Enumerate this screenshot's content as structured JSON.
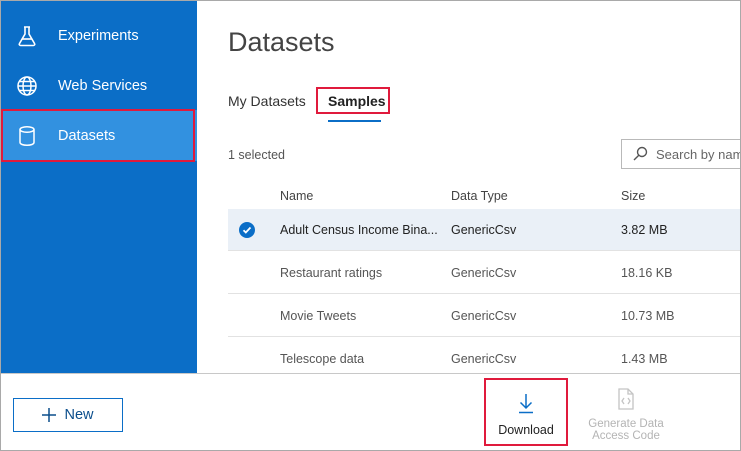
{
  "sidebar": {
    "items": [
      {
        "label": "Experiments",
        "icon": "flask-icon"
      },
      {
        "label": "Web Services",
        "icon": "globe-icon"
      },
      {
        "label": "Datasets",
        "icon": "database-icon",
        "active": true
      }
    ]
  },
  "main": {
    "title": "Datasets",
    "tabs": [
      {
        "label": "My Datasets",
        "active": false
      },
      {
        "label": "Samples",
        "active": true
      }
    ],
    "selection_status": "1 selected",
    "search": {
      "placeholder": "Search by name",
      "icon": "search-icon"
    },
    "table": {
      "columns": [
        "Name",
        "Data Type",
        "Size"
      ],
      "rows": [
        {
          "name": "Adult Census Income Bina...",
          "type": "GenericCsv",
          "size": "3.82 MB",
          "selected": true
        },
        {
          "name": "Restaurant ratings",
          "type": "GenericCsv",
          "size": "18.16 KB",
          "selected": false
        },
        {
          "name": "Movie Tweets",
          "type": "GenericCsv",
          "size": "10.73 MB",
          "selected": false
        },
        {
          "name": "Telescope data",
          "type": "GenericCsv",
          "size": "1.43 MB",
          "selected": false
        }
      ]
    }
  },
  "bottom_bar": {
    "new_label": "New",
    "download_label": "Download",
    "generate_label_line1": "Generate Data",
    "generate_label_line2": "Access Code"
  },
  "colors": {
    "sidebar_bg": "#0b6ec7",
    "sidebar_active": "#3291e0",
    "highlight_red": "#e01a3c",
    "selected_row": "#eaf0f7"
  }
}
